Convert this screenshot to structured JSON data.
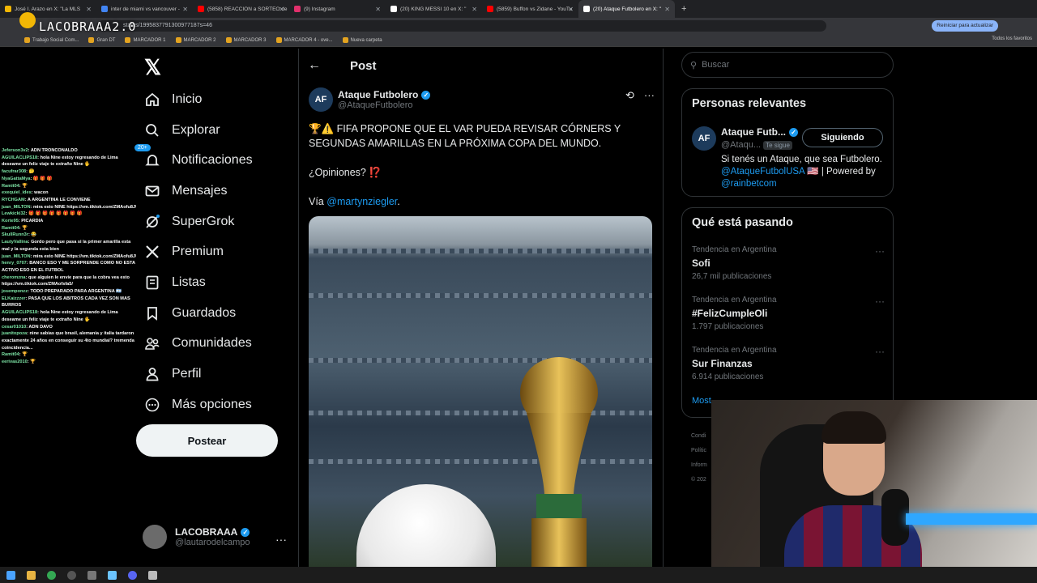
{
  "browser": {
    "tabs": [
      {
        "title": "José I. Arazo en X: \"La MLS",
        "color": "#f2b705"
      },
      {
        "title": "inter de miami vs vancouver -",
        "color": "#4285f4"
      },
      {
        "title": "(5858) REACCION a SORTEO de",
        "color": "#ff0000"
      },
      {
        "title": "(9) Instagram",
        "color": "#e1306c"
      },
      {
        "title": "(20) KING MESSI 10 en X: \"",
        "color": "#ffffff"
      },
      {
        "title": "(5859) Buffon vs Zidane - YouTu",
        "color": "#ff0000"
      },
      {
        "title": "(20) Ataque Futbolero en X: \"",
        "color": "#ffffff"
      }
    ],
    "new_tab": "+",
    "url": "status/1995837791300977187s=46",
    "update_button": "Reiniciar para actualizar",
    "bookmarks": [
      "Trabajo Social Com...",
      "Gran DT",
      "MARCADOR 1",
      "MARCADOR 2",
      "MARCADOR 3",
      "MARCADOR 4 - ove...",
      "Nueva carpeta"
    ],
    "all_bookmarks": "Todos los favoritos"
  },
  "stream": {
    "logo": "LACOBRAAA2.0",
    "chat": [
      {
        "user": "Jeferson3v2",
        "msg": "ADN TRONCONALDO"
      },
      {
        "user": "AGUILACLIPS18",
        "msg": "hola Nine estoy regresando de Lima deseame un feliz viaje te extraño Nine 🖐",
        "wrap": true
      },
      {
        "user": "facufrar308",
        "msg": "🤔"
      },
      {
        "user": "NyaGattaMya",
        "msg": "🎁 🎁 🎁"
      },
      {
        "user": "Ramit04",
        "msg": "🏆"
      },
      {
        "user": "exequiel_ides",
        "msg": "wacon"
      },
      {
        "user": "RYCHGAM",
        "msg": "A ARGENTINA LE CONVIENE"
      },
      {
        "user": "juan_MILTON",
        "msg": "mira esto NINE https://vm.tiktok.com/ZMAofu8JU"
      },
      {
        "user": "Lewkicki32",
        "msg": "🎁 🎁 🎁 🎁 🎁 🎁 🎁 🎁"
      },
      {
        "user": "Korte95",
        "msg": "PICARDIA"
      },
      {
        "user": "Ramit04",
        "msg": "🏆"
      },
      {
        "user": "SkullRunn3r",
        "msg": "😂"
      },
      {
        "user": "LautyVallina",
        "msg": "Gordo pero que pasa si la primer amarilla esta mal y la segunda esta bien",
        "wrap": true
      },
      {
        "user": "juan_MILTON",
        "msg": "mira esto NINE https://vm.tiktok.com/ZMAofu8JU"
      },
      {
        "user": "henry_0707",
        "msg": "BANCO ESO Y ME SORPRENDE COMO NO ESTA ACTIVO ESO EN EL FUTBOL",
        "wrap": true
      },
      {
        "user": "cheromzna",
        "msg": "que alguien le envie para que la cobra vea esto https://vm.tiktok.com/ZMAofsfa5/",
        "wrap": true
      },
      {
        "user": "josemponzz",
        "msg": "TODO PREPARADO PARA ARGENTINA 🇦🇷"
      },
      {
        "user": "ELKaizzzer",
        "msg": "PASA QUE LOS ABITROS CADA VEZ SON MAS BURROS",
        "wrap": true
      },
      {
        "user": "AGUILACLIPS18",
        "msg": "hola Nine estoy regresando de Lima deseame un feliz viaje te extraño Nine 🖐",
        "wrap": true
      },
      {
        "user": "cesar01010",
        "msg": "ADN DAVO"
      },
      {
        "user": "juanitopoza",
        "msg": "nine sabias que brasil, alemania y italia tardaron exactamente 24 años en conseguir su 4to mundial? tremenda coincidencia...",
        "wrap": true
      },
      {
        "user": "Ramit04",
        "msg": "🏆"
      },
      {
        "user": "eerivas2010",
        "msg": "🏆"
      }
    ]
  },
  "sidebar": {
    "nav": [
      {
        "label": "Inicio",
        "icon": "home-icon"
      },
      {
        "label": "Explorar",
        "icon": "search-icon"
      },
      {
        "label": "Notificaciones",
        "icon": "bell-icon",
        "badge": "20+"
      },
      {
        "label": "Mensajes",
        "icon": "mail-icon"
      },
      {
        "label": "SuperGrok",
        "icon": "grok-icon"
      },
      {
        "label": "Premium",
        "icon": "x-icon"
      },
      {
        "label": "Listas",
        "icon": "list-icon"
      },
      {
        "label": "Guardados",
        "icon": "bookmark-icon"
      },
      {
        "label": "Comunidades",
        "icon": "communities-icon"
      },
      {
        "label": "Perfil",
        "icon": "profile-icon"
      },
      {
        "label": "Más opciones",
        "icon": "more-icon"
      }
    ],
    "post_button": "Postear",
    "account": {
      "name": "LACOBRAAA",
      "handle": "@lautarodelcampo"
    }
  },
  "post": {
    "header": "Post",
    "author": {
      "name": "Ataque Futbolero",
      "handle": "@AtaqueFutbolero"
    },
    "text_1": "🏆⚠️ FIFA PROPONE QUE EL VAR PUEDA REVISAR CÓRNERS Y SEGUNDAS AMARILLAS EN LA PRÓXIMA COPA DEL MUNDO.",
    "text_2": "¿Opiniones? ⁉️",
    "via_prefix": "Vía ",
    "via_link": "@martynziegler",
    "via_suffix": "."
  },
  "right": {
    "search_placeholder": "Buscar",
    "relevant_title": "Personas relevantes",
    "relevant": {
      "name": "Ataque Futb...",
      "handle": "@Ataqu...",
      "follows_you": "Te sigue",
      "button": "Siguiendo",
      "bio": "Si tenés un Ataque, que sea Futbolero.",
      "bio_link": "@AtaqueFutbolUSA",
      "bio_mid": " 🇺🇸 | Powered by ",
      "bio_link2": "@rainbetcom"
    },
    "trends_title": "Qué está pasando",
    "trends": [
      {
        "context": "Tendencia en Argentina",
        "topic": "Sofi",
        "count": "26,7 mil publicaciones"
      },
      {
        "context": "Tendencia en Argentina",
        "topic": "#FelizCumpleOli",
        "count": "1.797 publicaciones"
      },
      {
        "context": "Tendencia en Argentina",
        "topic": "Sur Finanzas",
        "count": "6.914 publicaciones"
      }
    ],
    "show_more": "Most",
    "footer": [
      "Condi",
      "Polític",
      "Inform",
      "© 202"
    ]
  }
}
